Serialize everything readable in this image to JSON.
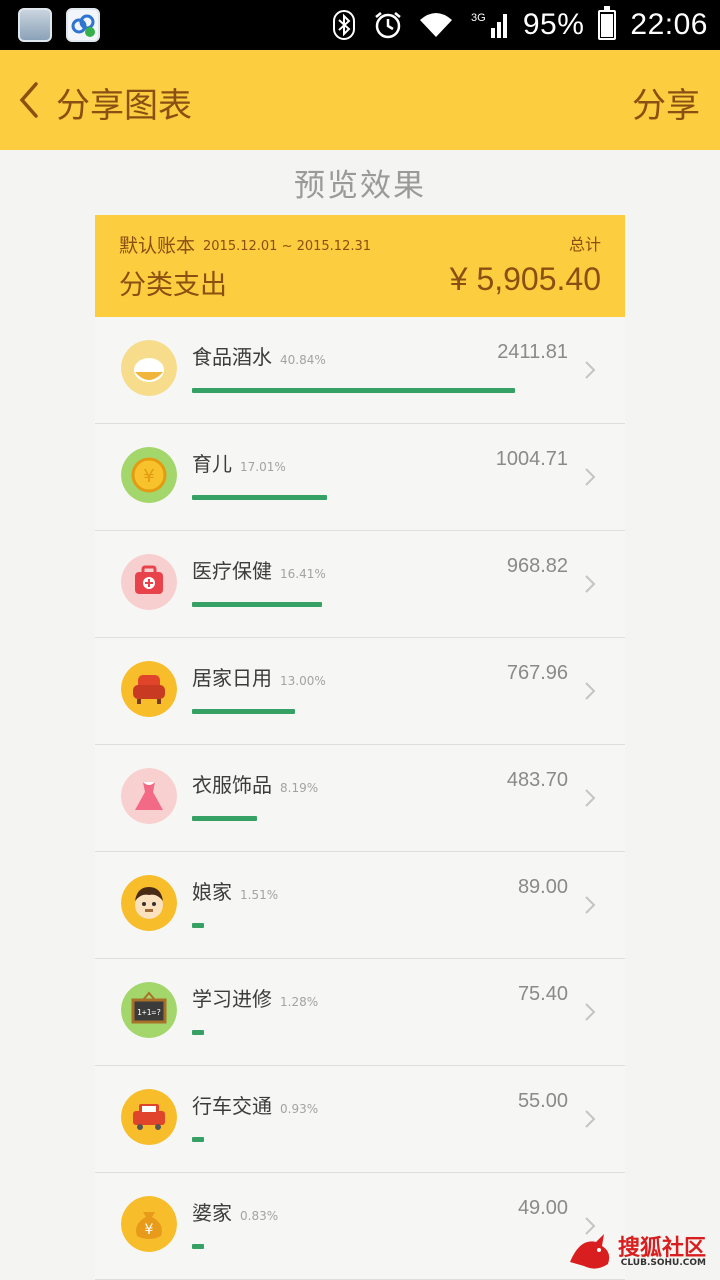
{
  "status_bar": {
    "network": "3G",
    "battery": "95%",
    "battery_level": 0.95,
    "time": "22:06"
  },
  "app_bar": {
    "title": "分享图表",
    "share_label": "分享"
  },
  "preview_label": "预览效果",
  "summary": {
    "book_name": "默认账本",
    "date_range": "2015.12.01 ~ 2015.12.31",
    "total_label": "总计",
    "kind_label": "分类支出",
    "total_amount": "¥ 5,905.40"
  },
  "categories": [
    {
      "name": "食品酒水",
      "percent": "40.84%",
      "share": 0.4084,
      "amount": "2411.81",
      "icon": "rice-bowl-icon",
      "color": "#f7dc8c"
    },
    {
      "name": "育儿",
      "percent": "17.01%",
      "share": 0.1701,
      "amount": "1004.71",
      "icon": "coin-icon",
      "color": "#a3d66b"
    },
    {
      "name": "医疗保健",
      "percent": "16.41%",
      "share": 0.1641,
      "amount": "968.82",
      "icon": "medical-kit-icon",
      "color": "#f8cfcf"
    },
    {
      "name": "居家日用",
      "percent": "13.00%",
      "share": 0.13,
      "amount": "767.96",
      "icon": "armchair-icon",
      "color": "#f7bd2a"
    },
    {
      "name": "衣服饰品",
      "percent": "8.19%",
      "share": 0.0819,
      "amount": "483.70",
      "icon": "dress-icon",
      "color": "#f8d0d0"
    },
    {
      "name": "娘家",
      "percent": "1.51%",
      "share": 0.0151,
      "amount": "89.00",
      "icon": "man-face-icon",
      "color": "#f7bd2a"
    },
    {
      "name": "学习进修",
      "percent": "1.28%",
      "share": 0.0128,
      "amount": "75.40",
      "icon": "chalkboard-icon",
      "color": "#a3d66b"
    },
    {
      "name": "行车交通",
      "percent": "0.93%",
      "share": 0.0093,
      "amount": "55.00",
      "icon": "car-icon",
      "color": "#f7bd2a"
    },
    {
      "name": "婆家",
      "percent": "0.83%",
      "share": 0.0083,
      "amount": "49.00",
      "icon": "money-bag-icon",
      "color": "#f7bd2a"
    }
  ],
  "watermark": {
    "text": "搜狐社区",
    "sub": "CLUB.SOHU.COM"
  }
}
